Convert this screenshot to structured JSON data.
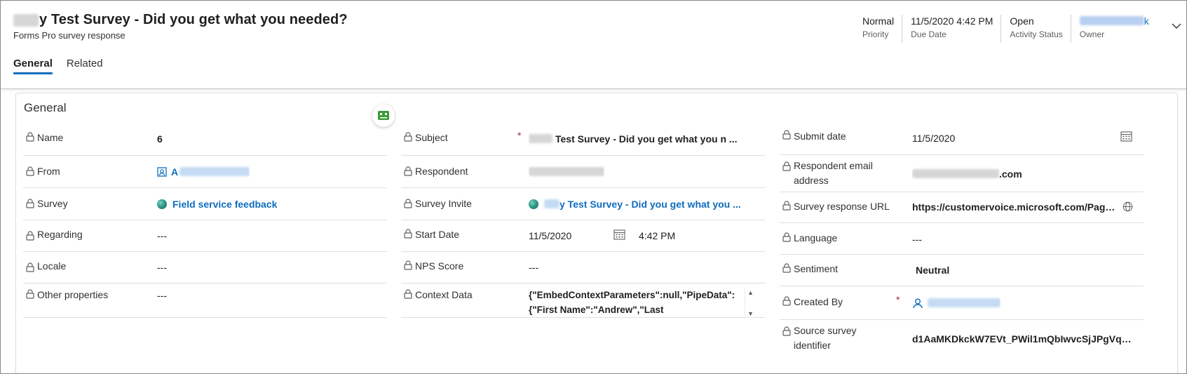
{
  "header": {
    "title_visible": "y Test Survey - Did you get what you needed?",
    "subtitle": "Forms Pro survey response",
    "fields": [
      {
        "value": "Normal",
        "label": "Priority"
      },
      {
        "value": "11/5/2020 4:42 PM",
        "label": "Due Date"
      },
      {
        "value": "Open",
        "label": "Activity Status"
      },
      {
        "value": "k",
        "label": "Owner"
      }
    ],
    "expand_icon": "chevron-down-icon"
  },
  "tabs": [
    {
      "label": "General",
      "active": true
    },
    {
      "label": "Related",
      "active": false
    }
  ],
  "section": {
    "title": "General",
    "col1": {
      "name": {
        "label": "Name",
        "value": "6"
      },
      "from": {
        "label": "From",
        "value": "A"
      },
      "survey": {
        "label": "Survey",
        "value": "Field service feedback"
      },
      "regarding": {
        "label": "Regarding",
        "value": "---"
      },
      "locale": {
        "label": "Locale",
        "value": "---"
      },
      "other": {
        "label": "Other properties",
        "value": "---"
      }
    },
    "col2": {
      "subject": {
        "label": "Subject",
        "value": "Test Survey - Did you get what you n ...",
        "required": "*"
      },
      "respondent": {
        "label": "Respondent"
      },
      "invite": {
        "label": "Survey Invite",
        "value": "y Test Survey - Did you get what you ..."
      },
      "start": {
        "label": "Start Date",
        "date": "11/5/2020",
        "time": "4:42 PM"
      },
      "nps": {
        "label": "NPS Score",
        "value": "---"
      },
      "context": {
        "label": "Context Data",
        "value": "{\"EmbedContextParameters\":null,\"PipeData\":{\"First Name\":\"Andrew\",\"Last"
      }
    },
    "col3": {
      "submit": {
        "label": "Submit date",
        "value": "11/5/2020"
      },
      "email": {
        "label_line1": "Respondent email",
        "label_line2": "address",
        "value": ".com"
      },
      "url": {
        "label": "Survey response URL",
        "value": "https://customervoice.microsoft.com/Page ..."
      },
      "language": {
        "label": "Language",
        "value": "---"
      },
      "sentiment": {
        "label": "Sentiment",
        "value": "Neutral"
      },
      "created": {
        "label": "Created By",
        "required": "*"
      },
      "source": {
        "label_line1": "Source survey",
        "label_line2": "identifier",
        "value": "d1AaMKDkckW7EVt_PWil1mQbIwvcSjJPgVq5P ..."
      }
    }
  },
  "colors": {
    "accent": "#0f6cbd",
    "required": "#a4262c",
    "border": "#e1dfdd",
    "bot_green": "#3a9b3a"
  }
}
